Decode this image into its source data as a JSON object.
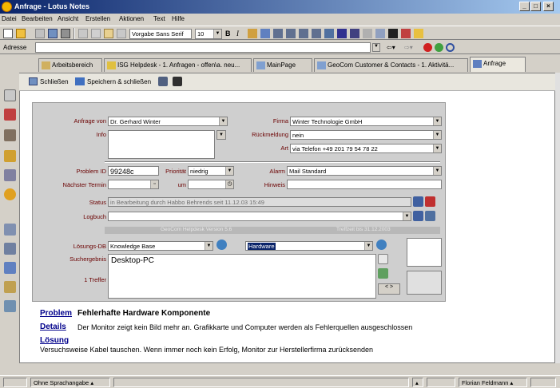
{
  "window": {
    "title": "Anfrage - Lotus Notes"
  },
  "menu": [
    "Datei",
    "Bearbeiten",
    "Ansicht",
    "Erstellen",
    "Aktionen",
    "Text",
    "Hilfe"
  ],
  "toolbar": {
    "font": "Vorgabe Sans Serif",
    "size": "10"
  },
  "address": {
    "label": "Adresse",
    "value": ""
  },
  "tabs": [
    {
      "label": "Arbeitsbereich",
      "icon": "workspace-icon"
    },
    {
      "label": "ISG Helpdesk - 1. Anfragen - offen\\a. neu...",
      "icon": "database-icon"
    },
    {
      "label": "MainPage",
      "icon": "page-icon"
    },
    {
      "label": "GeoCom Customer & Contacts - 1. Aktivitä...",
      "icon": "page-icon"
    },
    {
      "label": "Anfrage",
      "icon": "document-icon"
    }
  ],
  "actions": {
    "close": "Schließen",
    "save_close": "Speichern & schließen"
  },
  "form": {
    "anfrage_von_label": "Anfrage von",
    "anfrage_von": "Dr. Gerhard Winter",
    "firma_label": "Firma",
    "firma": "Winter Technologie GmbH",
    "info_label": "Info",
    "rueckmeldung_label": "Rückmeldung",
    "rueckmeldung": "nein",
    "art_label": "Art",
    "art": "via Telefon +49 201 79 54 78 22",
    "problem_id_label": "Problem ID",
    "problem_id": "99248c",
    "prioritaet_label": "Priorität",
    "prioritaet": "niedrig",
    "alarm_label": "Alarm",
    "alarm": "Mail Standard",
    "naechster_termin_label": "Nächster Termin",
    "um_label": "um",
    "hinweis_label": "Hinweis",
    "status_label": "Status",
    "status": "in Bearbeitung durch Habbo Behrends seit 11.12.03 15:49",
    "logbuch_label": "Logbuch",
    "version": "GeoCom Helpdesk Version 5.6",
    "trefferzeit": "Treffzeit bis 31.12.2003",
    "loesungs_db_label": "Lösungs-DB",
    "loesungs_db": "Knowledge Base",
    "kategorie": "Hardware",
    "suchergebnis_label": "Suchergebnis",
    "suchergebnis": "Desktop-PC",
    "treffer": "1 Treffer"
  },
  "body": {
    "problem_label": "Problem",
    "problem": "Fehlerhafte Hardware Komponente",
    "details_label": "Details",
    "details": "Der Monitor zeigt kein Bild mehr an. Grafikkarte und Computer werden als Fehlerquellen ausgeschlossen",
    "loesung_label": "Lösung",
    "loesung": "Versuchsweise Kabel tauschen. Wenn immer noch kein Erfolg, Monitor zur Herstellerfirma zurücksenden"
  },
  "status": {
    "language": "Ohne Sprachangabe",
    "user": "Florian Feldmann"
  }
}
